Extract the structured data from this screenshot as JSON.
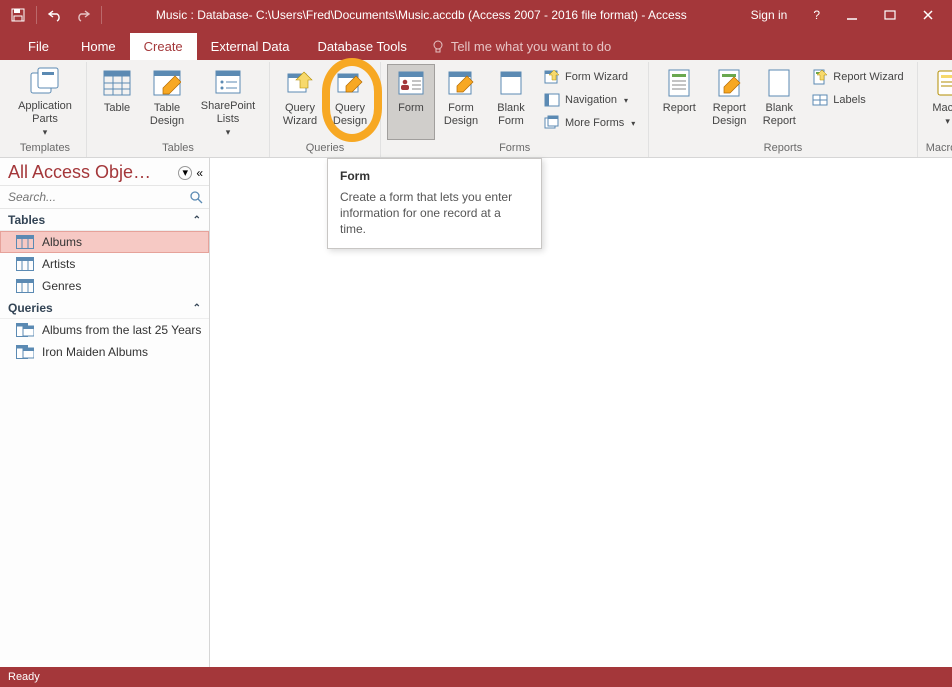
{
  "titlebar": {
    "title": "Music : Database- C:\\Users\\Fred\\Documents\\Music.accdb (Access 2007 - 2016 file format) - Access",
    "signin": "Sign in"
  },
  "tabs": {
    "file": "File",
    "home": "Home",
    "create": "Create",
    "external": "External Data",
    "dbtools": "Database Tools",
    "tellme": "Tell me what you want to do"
  },
  "ribbon": {
    "templates": {
      "label": "Templates",
      "appParts": "Application\nParts"
    },
    "tables": {
      "label": "Tables",
      "table": "Table",
      "tableDesign": "Table\nDesign",
      "sharepoint": "SharePoint\nLists"
    },
    "queries": {
      "label": "Queries",
      "wizard": "Query\nWizard",
      "design": "Query\nDesign"
    },
    "forms": {
      "label": "Forms",
      "form": "Form",
      "formDesign": "Form\nDesign",
      "blank": "Blank\nForm",
      "formWizard": "Form Wizard",
      "navigation": "Navigation",
      "moreForms": "More Forms"
    },
    "reports": {
      "label": "Reports",
      "report": "Report",
      "reportDesign": "Report\nDesign",
      "blankReport": "Blank\nReport",
      "reportWizard": "Report Wizard",
      "labels": "Labels"
    },
    "macros": {
      "label": "Macros & Code",
      "macro": "Macro"
    }
  },
  "tooltip": {
    "title": "Form",
    "body": "Create a form that lets you enter information for one record at a time."
  },
  "nav": {
    "title": "All Access Obje…",
    "searchPlaceholder": "Search...",
    "groupTables": "Tables",
    "groupQueries": "Queries",
    "tables": [
      "Albums",
      "Artists",
      "Genres"
    ],
    "queries": [
      "Albums from the last 25 Years",
      "Iron Maiden Albums"
    ]
  },
  "status": {
    "ready": "Ready"
  }
}
